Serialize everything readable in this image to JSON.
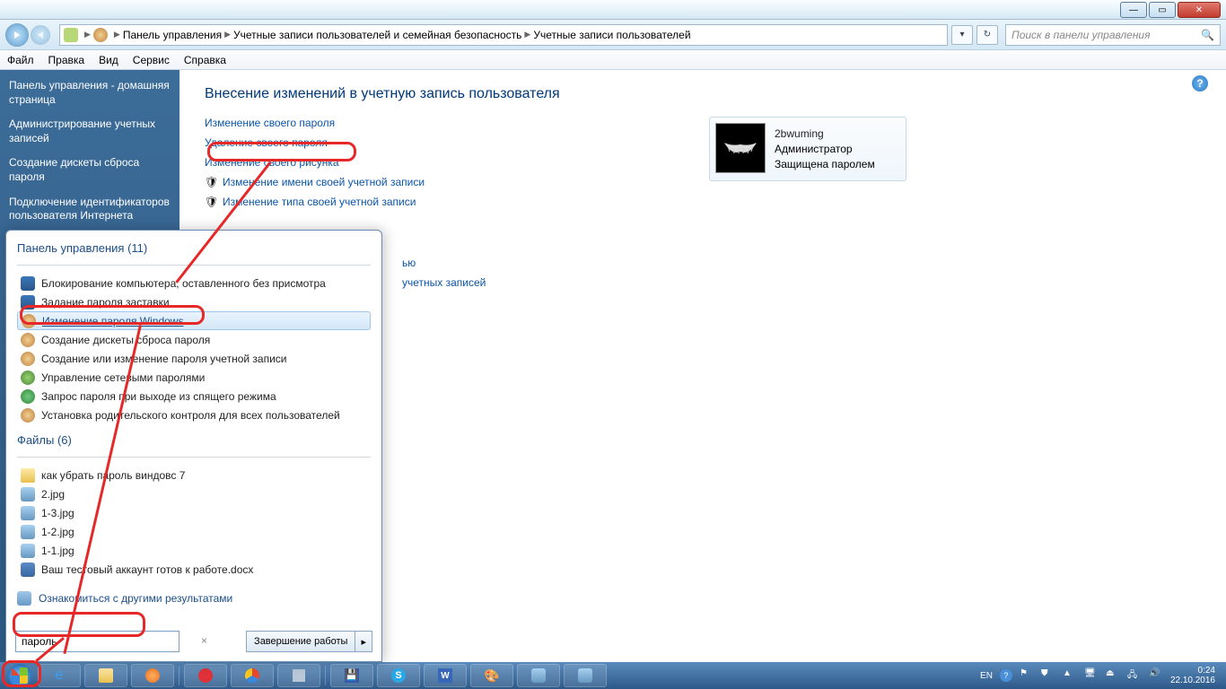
{
  "titlebar": {
    "min": "—",
    "max": "▭",
    "close": "✕"
  },
  "nav": {
    "crumbs": [
      "Панель управления",
      "Учетные записи пользователей и семейная безопасность",
      "Учетные записи пользователей"
    ],
    "refresh": "↻",
    "search_placeholder": "Поиск в панели управления"
  },
  "menubar": [
    "Файл",
    "Правка",
    "Вид",
    "Сервис",
    "Справка"
  ],
  "sidebar": {
    "items": [
      "Панель управления - домашняя страница",
      "Администрирование учетных записей",
      "Создание дискеты сброса пароля",
      "Подключение идентификаторов пользователя Интернета"
    ]
  },
  "content": {
    "title": "Внесение изменений в учетную запись пользователя",
    "links": [
      {
        "text": "Изменение своего пароля",
        "shield": false
      },
      {
        "text": "Удаление своего пароля",
        "shield": false
      },
      {
        "text": "Изменение своего рисунка",
        "shield": false
      },
      {
        "text": "Изменение имени своей учетной записи",
        "shield": true
      },
      {
        "text": "Изменение типа своей учетной записи",
        "shield": true
      }
    ],
    "extra_link_1": "ью",
    "extra_link_2": "учетных записей"
  },
  "user": {
    "name": "2bwuming",
    "role": "Администратор",
    "prot": "Защищена паролем"
  },
  "start": {
    "hdr_cp": "Панель управления",
    "hdr_cp_count": "(11)",
    "hdr_files": "Файлы",
    "hdr_files_count": "(6)",
    "cp_items": [
      {
        "text": "Блокирование компьютера, оставленного без присмотра",
        "icon": "ico-screen"
      },
      {
        "text": "Задание пароля заставки",
        "icon": "ico-screen"
      },
      {
        "text": "Изменение пароля Windows",
        "icon": "ico-users",
        "selected": true
      },
      {
        "text": "Создание дискеты сброса пароля",
        "icon": "ico-users"
      },
      {
        "text": "Создание или изменение пароля учетной записи",
        "icon": "ico-users"
      },
      {
        "text": "Управление сетевыми паролями",
        "icon": "ico-net"
      },
      {
        "text": "Запрос пароля при выходе из спящего режима",
        "icon": "ico-power"
      },
      {
        "text": "Установка родительского контроля для всех пользователей",
        "icon": "ico-users"
      }
    ],
    "file_items": [
      {
        "text": "как убрать пароль виндовс 7",
        "icon": "ico-folder"
      },
      {
        "text": "2.jpg",
        "icon": "ico-img"
      },
      {
        "text": "1-3.jpg",
        "icon": "ico-img"
      },
      {
        "text": "1-2.jpg",
        "icon": "ico-img"
      },
      {
        "text": "1-1.jpg",
        "icon": "ico-img"
      },
      {
        "text": "Ваш тестовый аккаунт готов к работе.docx",
        "icon": "ico-doc"
      }
    ],
    "seeall": "Ознакомиться с другими результатами",
    "query": "пароль",
    "clear": "×",
    "shutdown": "Завершение работы",
    "chev": "▸"
  },
  "tray": {
    "lang": "EN",
    "time": "0:24",
    "date": "22.10.2016"
  }
}
